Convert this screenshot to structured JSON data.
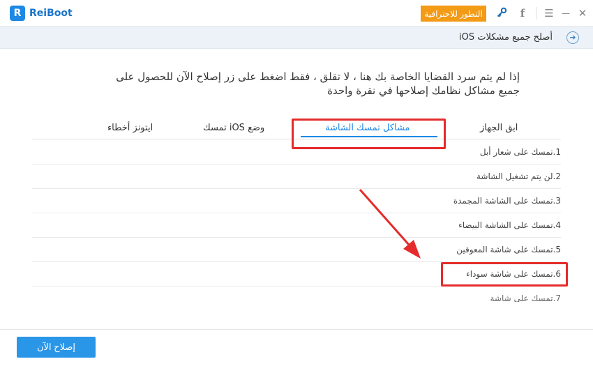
{
  "app": {
    "logo_letter": "R",
    "name": "ReiBoot"
  },
  "titlebar": {
    "pro_button": "التطور للاحترافية",
    "icons": {
      "key": "key-icon",
      "facebook": "facebook-icon",
      "menu": "menu-icon",
      "minimize": "minimize-icon",
      "close": "close-icon"
    },
    "facebook_glyph": "f",
    "menu_glyph": "☰",
    "minimize_glyph": "—",
    "close_glyph": "✕"
  },
  "subheader": {
    "title": "أصلح جميع مشكلات iOS",
    "back_glyph": "➜"
  },
  "intro": {
    "line1": "إذا لم يتم سرد القضايا الخاصة بك هنا ، لا تقلق ، فقط اضغط على زر إصلاح الآن للحصول على",
    "line2": "جميع مشاكل نظامك إصلاحها في نقرة واحدة"
  },
  "tabs": [
    {
      "label": "ابق الجهاز",
      "active": false
    },
    {
      "label": "مشاكل تمسك الشاشة",
      "active": true
    },
    {
      "label": "وضع iOS تمسك",
      "active": false
    },
    {
      "label": "ايتونز أخطاء",
      "active": false
    }
  ],
  "list": [
    "1.تمسك على شعار أبل",
    "2.لن يتم تشغيل الشاشة",
    "3.تمسك على الشاشة المجمدة",
    "4.تمسك على الشاشة البيضاء",
    "5.تمسك على شاشة المعوقين",
    "6.تمسك على شاشة سوداء",
    "7.تمسك على شاشة"
  ],
  "footer": {
    "fix_button": "إصلاح الآن"
  },
  "colors": {
    "accent": "#1e88e5",
    "highlight": "#e52b2b",
    "pro": "#f39a16"
  }
}
